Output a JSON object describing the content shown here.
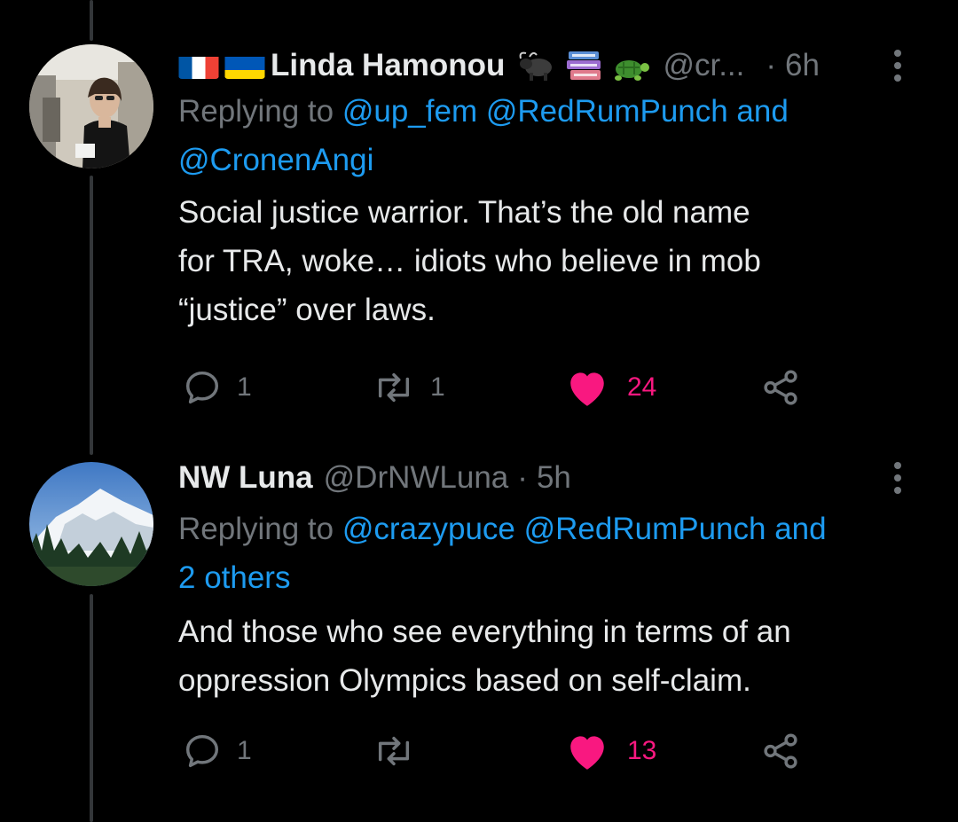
{
  "tweets": [
    {
      "display_name": "Linda Hamonou",
      "handle": "@cr...",
      "time": "6h",
      "flags": [
        "france-flag",
        "ukraine-flag"
      ],
      "name_emojis": [
        "water-buffalo-emoji",
        "books-emoji",
        "turtle-emoji"
      ],
      "replying_to_prefix": "Replying to",
      "replying_to_line1": "@up_fem @RedRumPunch and",
      "replying_to_line2": "@CronenAngi",
      "text_lines": [
        "Social justice warrior. That’s the old name",
        "for TRA, woke… idiots who believe in mob",
        "“justice” over laws."
      ],
      "reply_count": "1",
      "retweet_count": "1",
      "like_count": "24",
      "liked": true
    },
    {
      "display_name": "NW Luna",
      "handle": "@DrNWLuna",
      "time": "5h",
      "replying_to_prefix": "Replying to",
      "replying_to_line1": "@crazypuce @RedRumPunch and",
      "replying_to_line2": "2 others",
      "text_lines": [
        "And those who see everything in terms of an",
        "oppression Olympics based on self-claim."
      ],
      "reply_count": "1",
      "retweet_count": "",
      "like_count": "13",
      "liked": true
    }
  ],
  "colors": {
    "background": "#000000",
    "text": "#e7e9ea",
    "muted": "#71767b",
    "link": "#1d9bf0",
    "like": "#f91880",
    "thread_line": "#333639"
  }
}
